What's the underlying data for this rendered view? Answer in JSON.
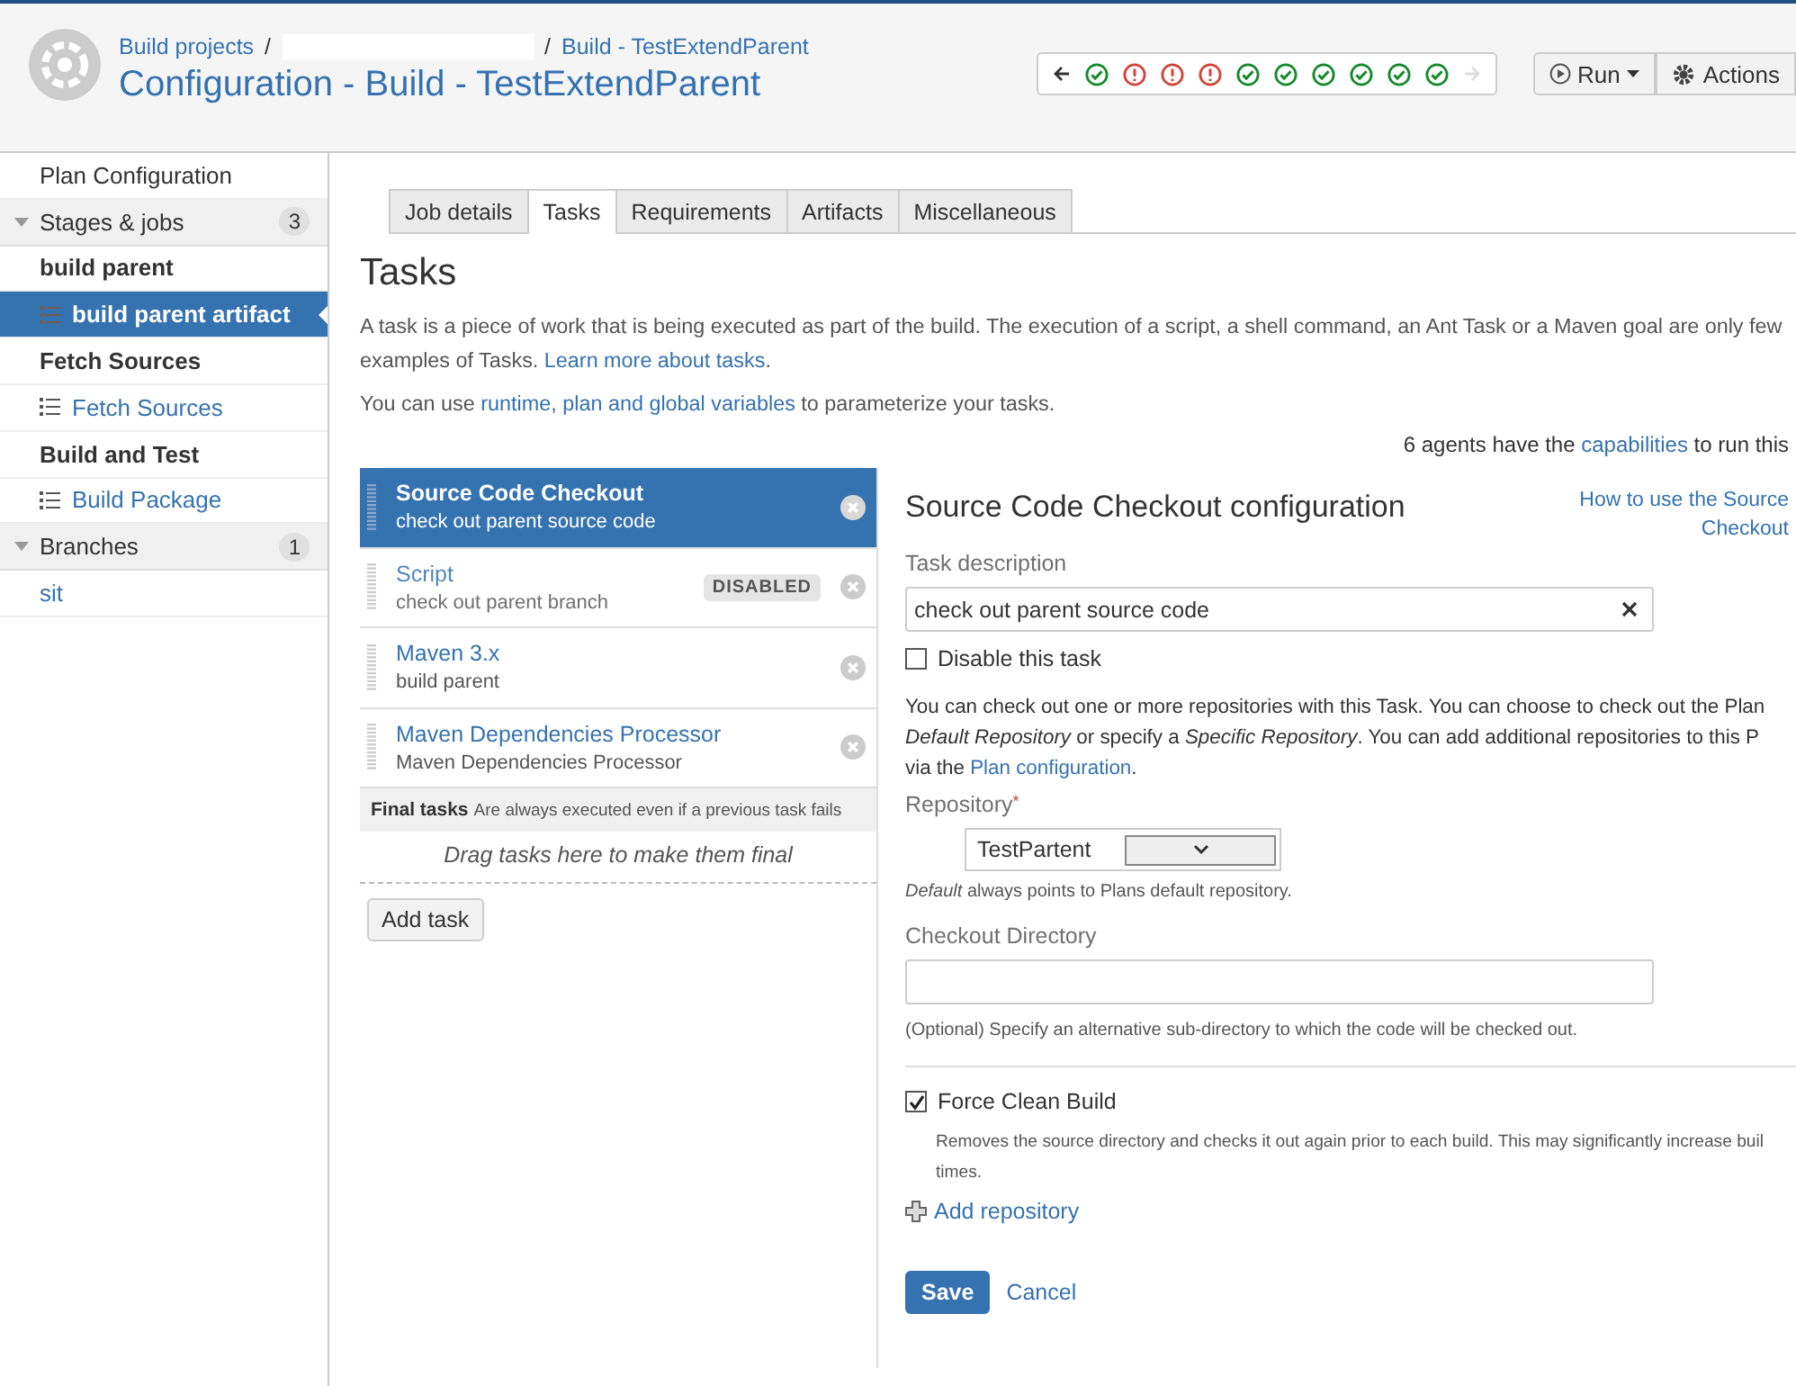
{
  "header": {
    "breadcrumbs": [
      {
        "label": "Build projects"
      },
      {
        "label": "Build - TestExtendParent"
      }
    ],
    "separator": "/",
    "title": "Configuration - Build - TestExtendParent",
    "builds": [
      {
        "failed": false
      },
      {
        "failed": true
      },
      {
        "failed": true
      },
      {
        "failed": true
      },
      {
        "failed": false
      },
      {
        "failed": false
      },
      {
        "failed": false
      },
      {
        "failed": false
      },
      {
        "failed": false
      },
      {
        "failed": false
      }
    ],
    "buttons": [
      {
        "kind": "run",
        "label": "Run"
      },
      {
        "kind": "actions",
        "label": "Actions"
      }
    ]
  },
  "sidebar": {
    "items": [
      {
        "kind": "plain",
        "label": "Plan Configuration",
        "selected": false
      },
      {
        "kind": "section",
        "label": "Stages & jobs",
        "count": "3",
        "selected": false
      },
      {
        "kind": "stage",
        "label": "build parent",
        "selected": false
      },
      {
        "kind": "job",
        "label": "build parent artifact",
        "selected": true
      },
      {
        "kind": "stage",
        "label": "Fetch Sources",
        "selected": false
      },
      {
        "kind": "job",
        "label": "Fetch Sources",
        "selected": false
      },
      {
        "kind": "stage",
        "label": "Build and Test",
        "selected": false
      },
      {
        "kind": "job",
        "label": "Build Package",
        "selected": false
      },
      {
        "kind": "section",
        "label": "Branches",
        "count": "1",
        "selected": false
      },
      {
        "kind": "branch",
        "label": "sit",
        "selected": false
      }
    ]
  },
  "tabs": [
    {
      "label": "Job details",
      "selected": false
    },
    {
      "label": "Tasks",
      "selected": true
    },
    {
      "label": "Requirements",
      "selected": false
    },
    {
      "label": "Artifacts",
      "selected": false
    },
    {
      "label": "Miscellaneous",
      "selected": false
    }
  ],
  "tasks": {
    "title": "Tasks",
    "intro": [
      {
        "text": "A task is a piece of work that is being executed as part of the build. The execution of a script, a shell command, an Ant Task or a Maven goal are only few"
      },
      {
        "text": "examples of Tasks. ",
        "link": "Learn more about tasks",
        "after": "."
      }
    ],
    "variables": [
      {
        "text": "You can use ",
        "link": "runtime, plan and global variables",
        "after": " to parameterize your tasks."
      }
    ],
    "agents": [
      {
        "text": "6 agents have the ",
        "link": "capabilities",
        "after": " to run this"
      }
    ]
  },
  "task_list": {
    "items": [
      {
        "title": "Source Code Checkout",
        "description": "check out parent source code",
        "selected": true,
        "disabled": false
      },
      {
        "title": "Script",
        "description": "check out parent branch",
        "selected": false,
        "disabled": true,
        "badge": "DISABLED"
      },
      {
        "title": "Maven 3.x",
        "description": "build parent",
        "selected": false,
        "disabled": false
      },
      {
        "title": "Maven Dependencies Processor",
        "description": "Maven Dependencies Processor",
        "selected": false,
        "disabled": false
      }
    ],
    "final_tasks": {
      "label": "Final tasks",
      "note": "Are always executed even if a previous task fails"
    },
    "drop_hint": "Drag tasks here to make them final",
    "add_button": "Add task"
  },
  "config": {
    "title": "Source Code Checkout configuration",
    "help_link": [
      "How to use the Source",
      "Checkout"
    ],
    "task_description": {
      "label": "Task description",
      "value": "check out parent source code"
    },
    "disable_task": {
      "label": "Disable this task",
      "checked": false
    },
    "repositories_help": [
      {
        "text": "You can check out one or more repositories with this Task. You can choose to check out the Plan"
      },
      {
        "text": "*Default Repository* or specify a *Specific Repository*. You can add additional repositories to this P"
      },
      {
        "text": "via the ",
        "link": "Plan configuration",
        "after": "."
      }
    ],
    "repository": {
      "label": "Repository",
      "required": true,
      "required_mark": "*",
      "value": "TestPartent",
      "hint": "*Default* always points to Plans default repository."
    },
    "checkout_directory": {
      "label": "Checkout Directory",
      "hint": "(Optional) Specify an alternative sub-directory to which the code will be checked out."
    },
    "force_clean": {
      "label": "Force Clean Build",
      "checked": true,
      "description": [
        "Removes the source directory and checks it out again prior to each build. This may significantly increase buil",
        "times."
      ]
    },
    "add_repository": "Add repository",
    "save": "Save",
    "cancel": "Cancel"
  }
}
